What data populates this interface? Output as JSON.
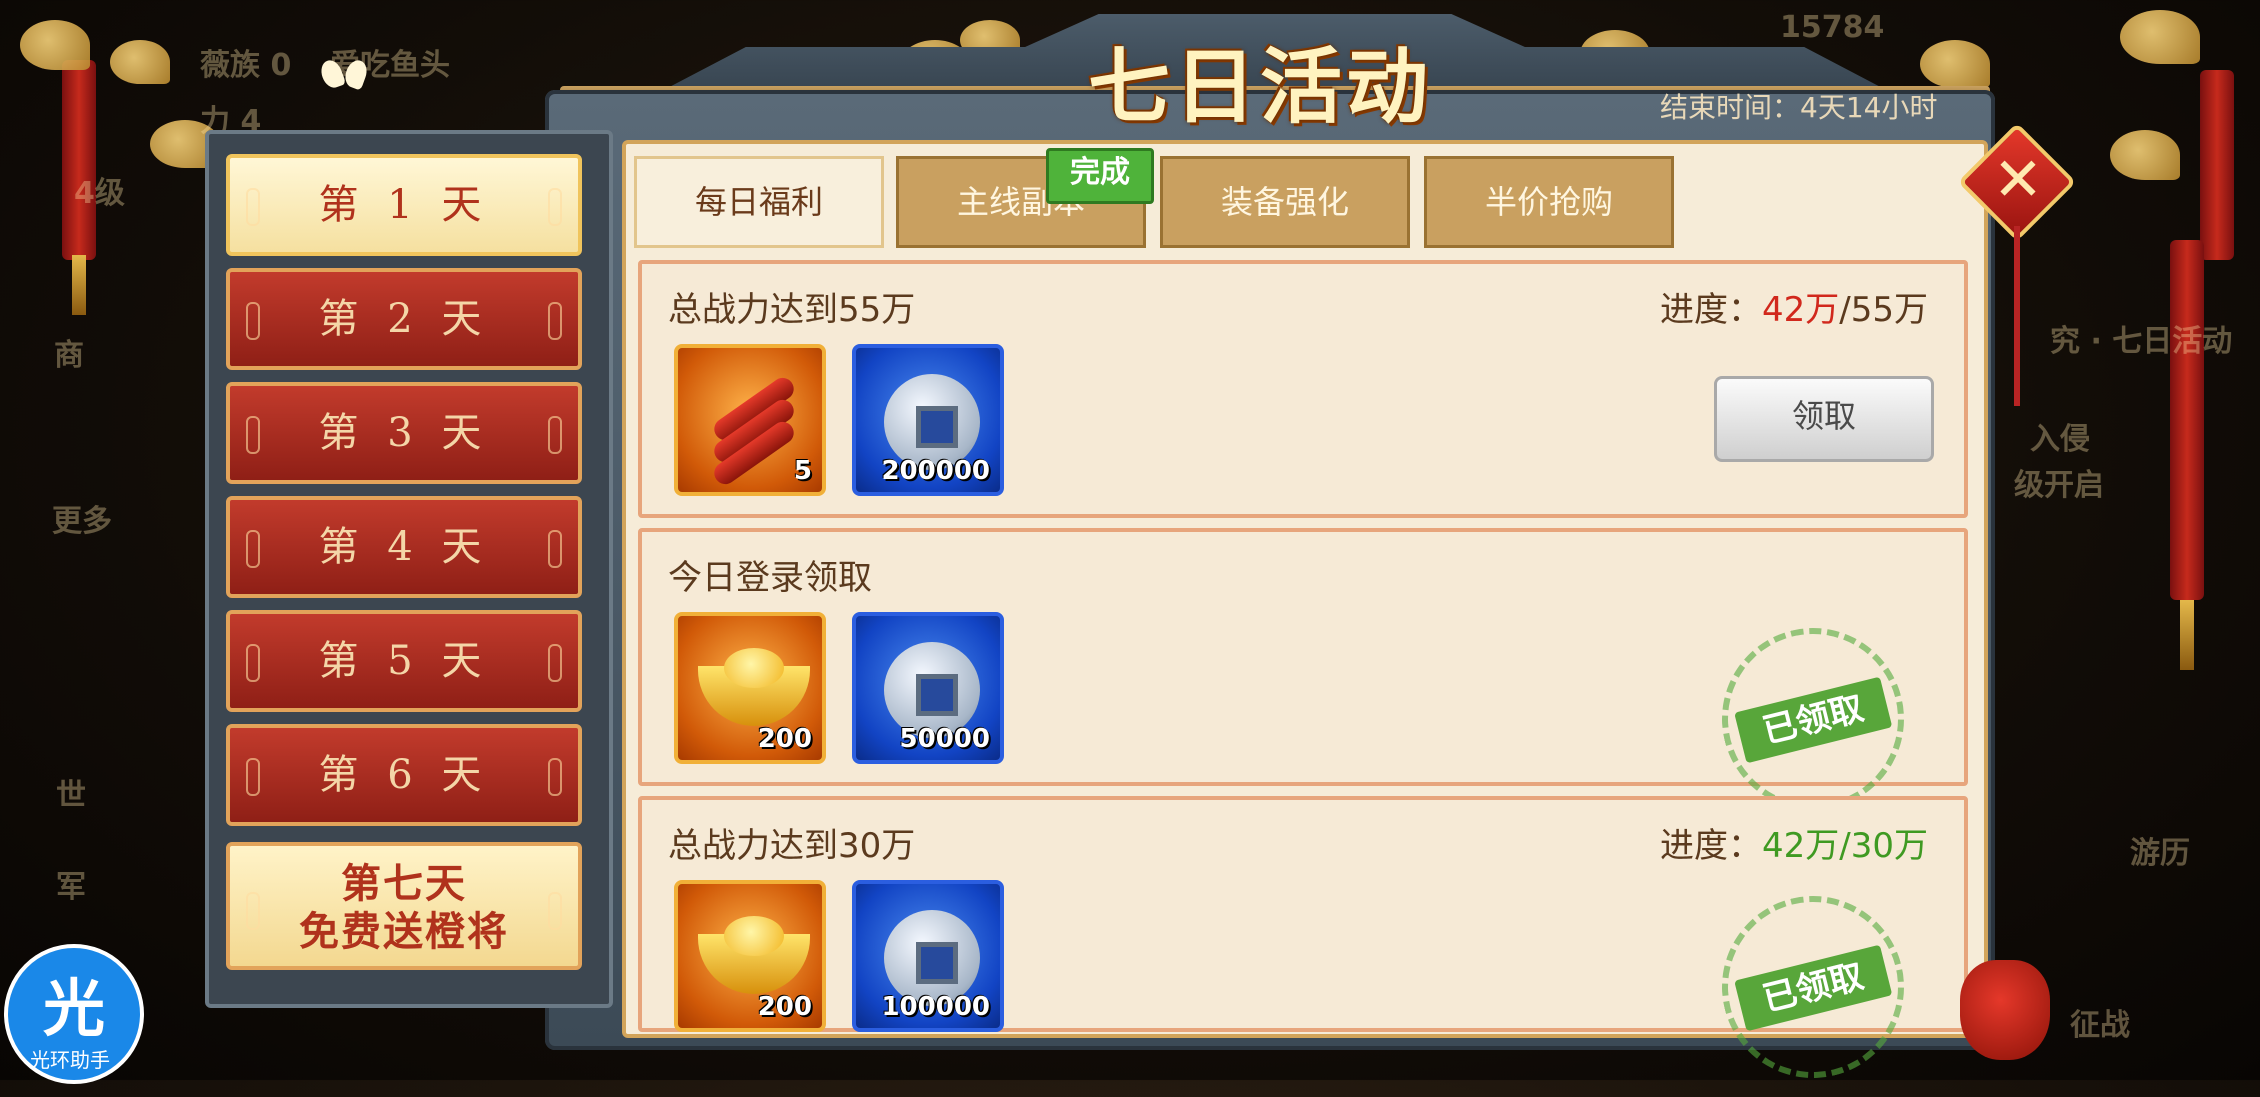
{
  "background": {
    "texts": [
      "薇族 0",
      "爱吃鱼头",
      "力 4",
      "4级",
      "商",
      "更多",
      "世",
      "军",
      "15784",
      "究 · 七日活动",
      "入侵",
      "级开启",
      "游历",
      "征战"
    ]
  },
  "header": {
    "title": "七日活动",
    "end_time": "结束时间：4天14小时"
  },
  "days": [
    {
      "label": "第 1 天",
      "active": true
    },
    {
      "label": "第 2 天"
    },
    {
      "label": "第 3 天"
    },
    {
      "label": "第 4 天"
    },
    {
      "label": "第 5 天"
    },
    {
      "label": "第 6 天"
    },
    {
      "line1": "第七天",
      "line2": "免费送橙将",
      "special": true
    }
  ],
  "tabs": [
    {
      "label": "每日福利",
      "active": true
    },
    {
      "label": "主线副本",
      "badge": "完成"
    },
    {
      "label": "装备强化"
    },
    {
      "label": "半价抢购"
    }
  ],
  "tasks": [
    {
      "title": "总战力达到55万",
      "progress_label": "进度：",
      "progress_current": "42万",
      "progress_sep": "/",
      "progress_target": "55万",
      "rewards": [
        {
          "icon": "firecracker-icon",
          "count": "5"
        },
        {
          "icon": "silver-coin-icon",
          "count": "200000"
        }
      ],
      "action_label": "领取"
    },
    {
      "title": "今日登录领取",
      "rewards": [
        {
          "icon": "gold-ingot-icon",
          "count": "200"
        },
        {
          "icon": "silver-coin-icon",
          "count": "50000"
        }
      ],
      "stamp_label": "已领取"
    },
    {
      "title": "总战力达到30万",
      "progress_label": "进度：",
      "progress_current": "42万",
      "progress_sep": "/",
      "progress_target": "30万",
      "rewards": [
        {
          "icon": "gold-ingot-icon",
          "count": "200"
        },
        {
          "icon": "silver-coin-icon",
          "count": "100000"
        }
      ],
      "stamp_label": "已领取"
    }
  ],
  "overlay": {
    "helper_char": "光",
    "helper_text": "光环助手"
  },
  "colors": {
    "accent_red": "#d1281c",
    "accent_green": "#3f9a22",
    "tab_active": "#f8efdc"
  }
}
